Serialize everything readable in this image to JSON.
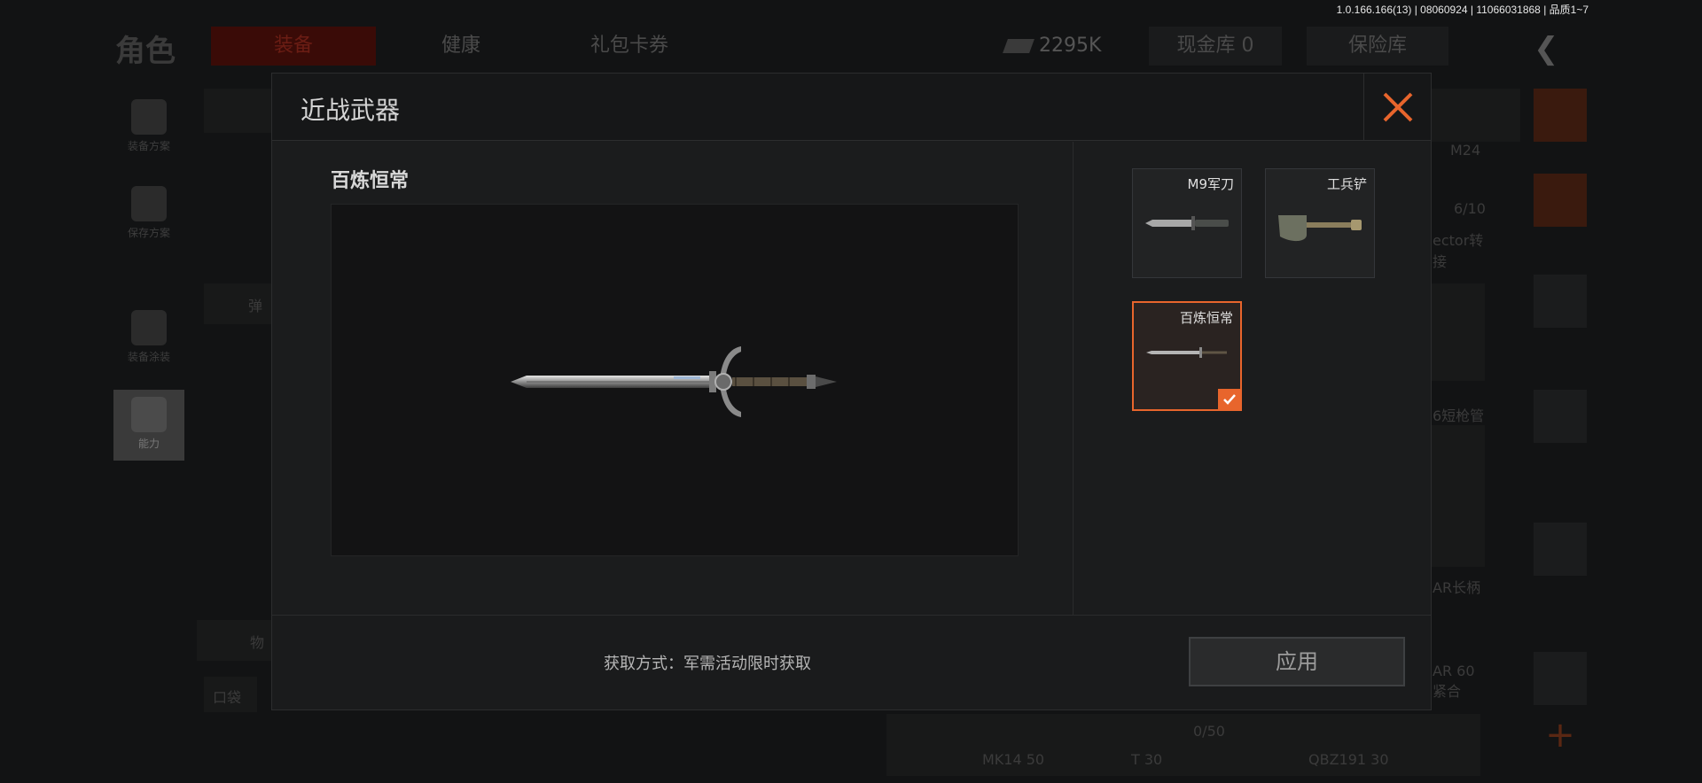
{
  "version_info": "1.0.166.166(13) | 08060924 | 11066031868 | 品质1~7",
  "background": {
    "page_title": "角色",
    "tabs": [
      "装备",
      "健康",
      "礼包卡券"
    ],
    "currency_amount": "2295K",
    "cash_vault": "现金库 0",
    "safe_box": "保险库",
    "sidebar": [
      "装备方案",
      "保存方案",
      "装备涂装",
      "能力"
    ],
    "left_labels": [
      "弹",
      "物",
      "口袋"
    ],
    "right_labels": [
      "M24",
      "6/10",
      "ector转接",
      "6短枪管",
      "AR长柄",
      "AR 60紧合"
    ],
    "bottom_items": [
      "0/50",
      "MK14 50",
      "T 30",
      "QBZ191 30"
    ]
  },
  "modal": {
    "title": "近战武器",
    "preview": {
      "name": "百炼恒常"
    },
    "weapons": [
      {
        "name": "M9军刀",
        "icon": "bayonet-icon",
        "selected": false
      },
      {
        "name": "工兵铲",
        "icon": "shovel-icon",
        "selected": false
      },
      {
        "name": "百炼恒常",
        "icon": "sword-icon",
        "selected": true
      }
    ],
    "acquire_text": "获取方式：军需活动限时获取",
    "apply_label": "应用",
    "colors": {
      "accent": "#e8652c",
      "panel": "#1b1c1d"
    }
  }
}
